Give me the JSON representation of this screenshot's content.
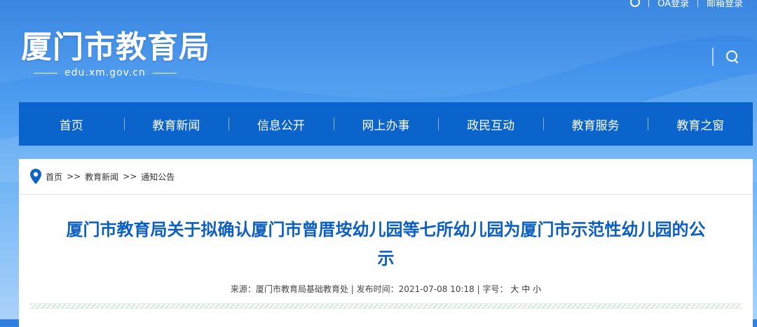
{
  "header": {
    "top_links": [
      "OA登录",
      "邮箱登录"
    ],
    "site_title": "厦门市教育局",
    "site_domain": "edu.xm.gov.cn"
  },
  "nav": {
    "items": [
      "首页",
      "教育新闻",
      "信息公开",
      "网上办事",
      "政民互动",
      "教育服务",
      "教育之窗"
    ]
  },
  "breadcrumb": {
    "items": [
      "首页",
      "教育新闻",
      "通知公告"
    ],
    "separator": ">>"
  },
  "article": {
    "title": "厦门市教育局关于拟确认厦门市曾厝垵幼儿园等七所幼儿园为厦门市示范性幼儿园的公示",
    "meta": {
      "source_label": "来源：",
      "source": "厦门市教育局基础教育处",
      "publish_label": "发布时间：",
      "publish_time": "2021-07-08 10:18",
      "font_size_label": "字号：",
      "font_sizes": [
        "大",
        "中",
        "小"
      ]
    }
  },
  "colors": {
    "nav_bg": "#0a64cc",
    "title_blue": "#0b5fc4"
  },
  "icons": {
    "top_icon": "circle-icon",
    "search": "search-icon",
    "breadcrumb": "location-pin-icon"
  }
}
